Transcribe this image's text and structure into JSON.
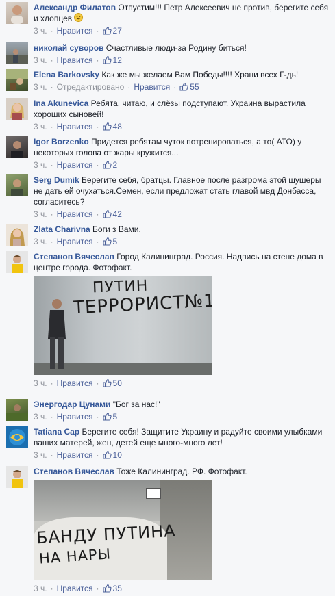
{
  "ui": {
    "like_label": "Нравится",
    "edited_label": "Отредактировано"
  },
  "comments": [
    {
      "author": "Александр Филатов",
      "text": "Отпустим!!! Петр Алексеевич не против, берегите себя и хлопцев",
      "time": "3 ч.",
      "likes": "27",
      "emoji": "smile-icon"
    },
    {
      "author": "николай суворов",
      "text": "Счастливые люди-за Родину биться!",
      "time": "3 ч.",
      "likes": "12"
    },
    {
      "author": "Elena Barkovsky",
      "text": "Как же мы желаем Вам Победы!!!! Храни всех Г-дь!",
      "time": "3 ч.",
      "likes": "55",
      "edited": true
    },
    {
      "author": "Ina Akunevica",
      "text": "Ребята, читаю, и слёзы подступают. Украина вырастила хороших сыновей!",
      "time": "3 ч.",
      "likes": "48"
    },
    {
      "author": "Igor Borzenko",
      "text": "Придется ребятам чуток потренироваться, а то( АТО) у некоторых голова от жары кружится...",
      "time": "3 ч.",
      "likes": "2"
    },
    {
      "author": "Serg Dumik",
      "text": "Берегите себя, братцы. Главное после разгрома этой шушеры не дать ей очухаться.Семен, если предложат стать главой мвд Донбасса, согласитесь?",
      "time": "3 ч.",
      "likes": "42"
    },
    {
      "author": "Zlata Charivna",
      "text": "Боги з Вами.",
      "time": "3 ч.",
      "likes": "5"
    },
    {
      "author": "Степанов Вячеслав",
      "text": "Город Калининград. Россия. Надпись на стене дома в центре города. Фотофакт.",
      "time": "3 ч.",
      "likes": "50",
      "photo": {
        "line1": "ПУТИН",
        "line2": "ТЕРРОРИСТ№1"
      }
    },
    {
      "author": "Энергодар Цунами",
      "text": "\"Бог за нас!\"",
      "time": "3 ч.",
      "likes": "5"
    },
    {
      "author": "Tatiana Cap",
      "text": "Берегите себя! Защитите Украину и радуйте своими улыбками ваших матерей, жен, детей еще много-много лет!",
      "time": "3 ч.",
      "likes": "10"
    },
    {
      "author": "Степанов Вячеслав",
      "text": "Тоже Калининград. РФ. Фотофакт.",
      "time": "3 ч.",
      "likes": "35",
      "photo": {
        "line1": "БАНДУ ПУТИНА",
        "line2": "НА НАРЫ"
      }
    }
  ],
  "colors": {
    "link": "#365899",
    "meta": "#90949c",
    "like": "#4b6099",
    "background": "#f6f7f9"
  }
}
